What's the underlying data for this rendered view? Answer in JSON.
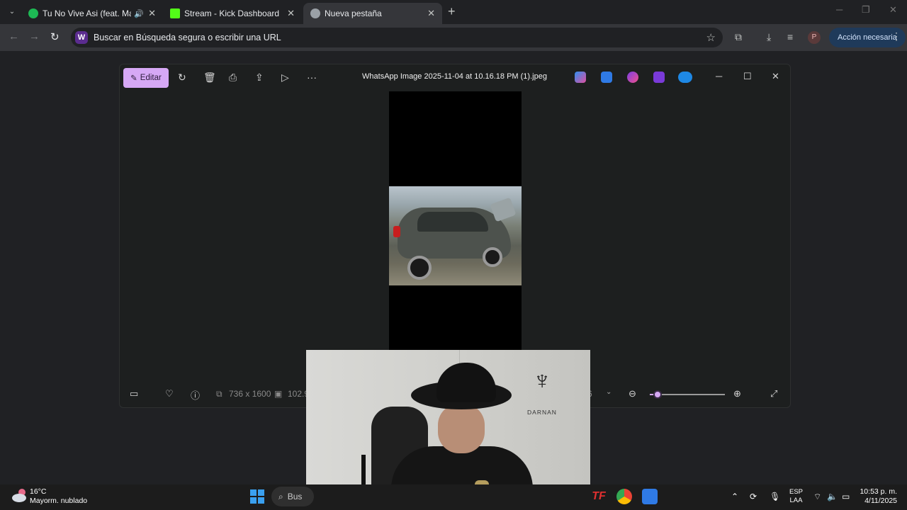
{
  "browser": {
    "tabs": [
      {
        "title": "Tu No Vive Asi (feat. Mamb",
        "favicon_color": "#1db954",
        "icon": "spotify-icon",
        "audio": true,
        "active": false
      },
      {
        "title": "Stream - Kick Dashboard",
        "favicon_color": "#53fc18",
        "icon": "kick-icon",
        "audio": false,
        "active": false
      },
      {
        "title": "Nueva pestaña",
        "favicon_color": "#9aa0a6",
        "icon": "globe-icon",
        "audio": false,
        "active": true
      }
    ],
    "omnibox_placeholder": "Buscar en Búsqueda segura o escribir una URL",
    "omnibox_badge": "W",
    "profile_initial": "P",
    "action_label": "Acción necesaria"
  },
  "photos_app": {
    "edit_label": "Editar",
    "title": "WhatsApp Image 2025-11-04 at 10.16.18 PM (1).jpeg",
    "dimensions": "736 x 1600",
    "file_size": "102.9",
    "zoom_value": "6",
    "zoom_level": 0.1,
    "accent": "#d6a8f5"
  },
  "webcam": {
    "logo_text": "DARNAN"
  },
  "taskbar": {
    "weather_temp": "16°C",
    "weather_desc": "Mayorm. nublado",
    "search_label": "Bus",
    "lang_top": "ESP",
    "lang_bottom": "LAA",
    "time": "10:53 p. m.",
    "date": "4/11/2025"
  }
}
